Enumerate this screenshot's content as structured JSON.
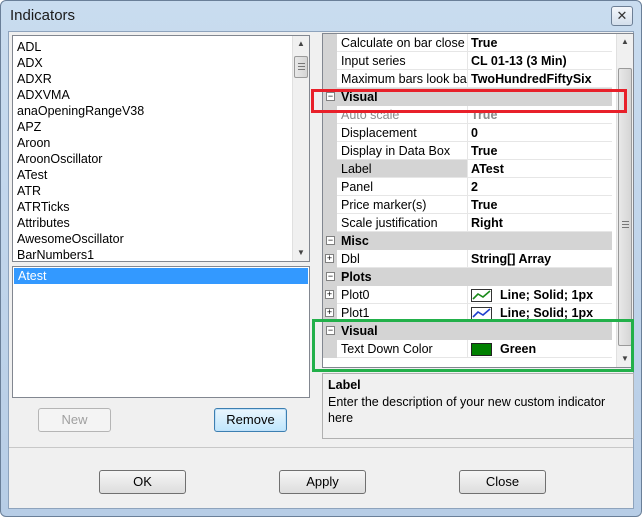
{
  "window": {
    "title": "Indicators",
    "close_glyph": "✕"
  },
  "indicator_list": {
    "items": [
      "ADL",
      "ADX",
      "ADXR",
      "ADXVMA",
      "anaOpeningRangeV38",
      "APZ",
      "Aroon",
      "AroonOscillator",
      "ATest",
      "ATR",
      "ATRTicks",
      "Attributes",
      "AwesomeOscillator",
      "BarNumbers1"
    ]
  },
  "applied_list": {
    "items": [
      "Atest"
    ],
    "selected": 0
  },
  "left_buttons": {
    "new_label": "New",
    "remove_label": "Remove"
  },
  "properties": {
    "rows_top": [
      {
        "name": "Calculate on bar close",
        "value": "True"
      },
      {
        "name": "Input series",
        "value": "CL 01-13 (3 Min)"
      },
      {
        "name": "Maximum bars look back",
        "value": "TwoHundredFiftySix"
      }
    ],
    "visual_category": "Visual",
    "visual_rows": [
      {
        "name": "Auto scale",
        "value": "True",
        "disabled": true
      },
      {
        "name": "Displacement",
        "value": "0"
      },
      {
        "name": "Display in Data Box",
        "value": "True"
      },
      {
        "name": "Label",
        "value": "ATest",
        "selected": true
      },
      {
        "name": "Panel",
        "value": "2"
      },
      {
        "name": "Price marker(s)",
        "value": "True"
      },
      {
        "name": "Scale justification",
        "value": "Right"
      }
    ],
    "misc_category": "Misc",
    "misc_rows": [
      {
        "name": "Dbl",
        "value": "String[] Array"
      }
    ],
    "plots_category": "Plots",
    "plot_rows": [
      {
        "name": "Plot0",
        "value": "Line; Solid; 1px",
        "color": "#1a8a1a"
      },
      {
        "name": "Plot1",
        "value": "Line; Solid; 1px",
        "color": "#1f3fcf"
      }
    ],
    "visual2_category": "Visual",
    "visual2_rows": [
      {
        "name": "Text Down Color",
        "value": "Green",
        "color": "#008000"
      }
    ]
  },
  "description": {
    "title": "Label",
    "text": "Enter the description of your new custom indicator here"
  },
  "annotations": {
    "red_box_color": "#e8202a",
    "green_box_color": "#22b04a"
  },
  "footer": {
    "ok_label": "OK",
    "apply_label": "Apply",
    "close_label": "Close"
  }
}
